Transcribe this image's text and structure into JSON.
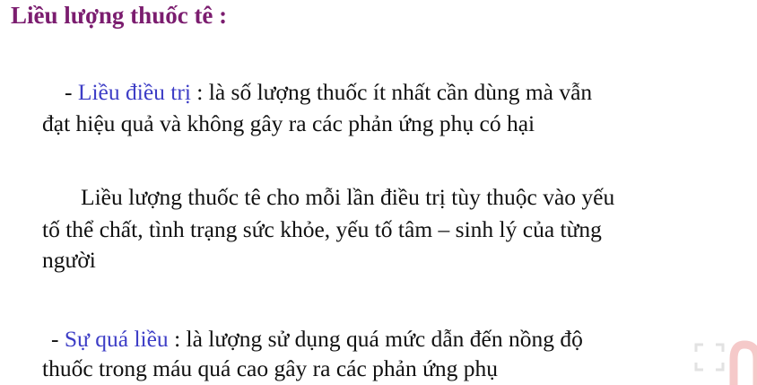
{
  "title": "Liều lượng thuốc tê :",
  "sections": [
    {
      "prefix": "- ",
      "term": "Liều điều trị",
      "lines": [
        " : là số lượng thuốc ít nhất cần dùng mà vẫn",
        "đạt hiệu quả và không gây ra các phản ứng phụ có hại"
      ]
    },
    {
      "lines": [
        "Liều lượng thuốc tê cho mỗi lần điều trị tùy thuộc vào yếu",
        "tố thể chất, tình trạng sức khỏe, yếu tố tâm – sinh lý của từng",
        "người"
      ]
    },
    {
      "prefix": "- ",
      "term": "Sự quá liều",
      "lines": [
        " : là lượng sử dụng quá mức dẫn đến nồng độ",
        "thuốc trong máu quá cao gây ra các phản ứng phụ"
      ]
    }
  ],
  "colors": {
    "title": "#7b1d6f",
    "term": "#3d3dc6"
  }
}
